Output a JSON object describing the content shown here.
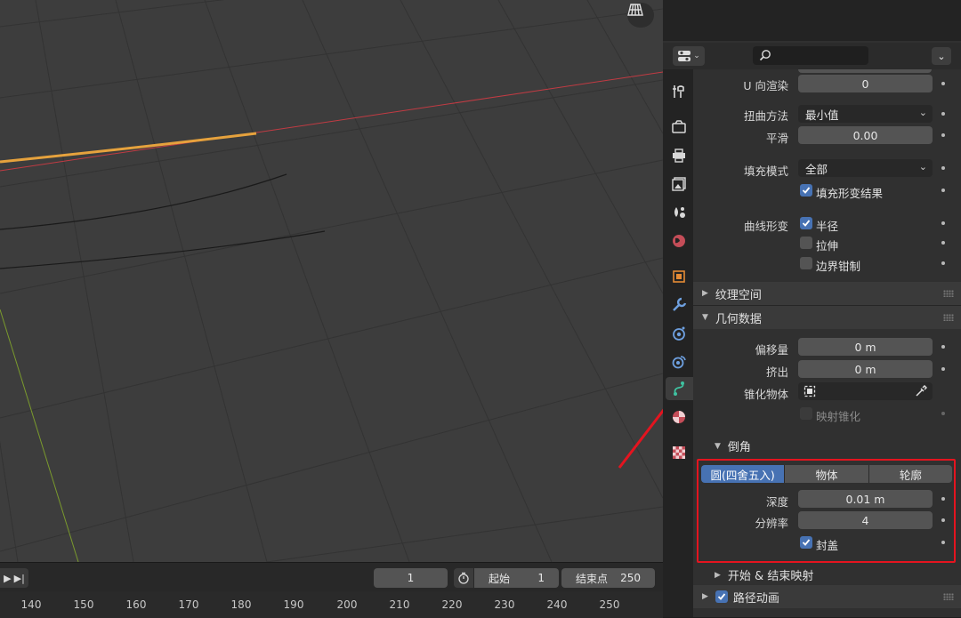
{
  "viewport": {
    "gizmo_icon": "grid-view-icon",
    "colors": {
      "bg": "#3d3d3d",
      "x_axis": "#c13b43",
      "y_axis": "#7a9a2d",
      "curve_selected": "#e6a23d",
      "grid": "#353535"
    }
  },
  "timeline": {
    "current_frame": "1",
    "start_label": "起始",
    "start_value": "1",
    "end_label": "结束点",
    "end_value": "250",
    "ticks": [
      "140",
      "150",
      "160",
      "170",
      "180",
      "190",
      "200",
      "210",
      "220",
      "230",
      "240",
      "250"
    ]
  },
  "properties": {
    "search_placeholder": "",
    "tabs": [
      "tool-icon",
      "render-icon",
      "output-icon",
      "view-layer-icon",
      "scene-icon",
      "world-icon",
      "object-icon",
      "modifier-icon",
      "particles-icon",
      "physics-icon",
      "curve-data-icon",
      "material-icon",
      "texture-icon"
    ],
    "active_tab": "curve-data-icon",
    "u_render": {
      "label": "U 向渲染",
      "value": "0"
    },
    "twist_method": {
      "label": "扭曲方法",
      "value": "最小值"
    },
    "smooth": {
      "label": "平滑",
      "value": "0.00"
    },
    "fill_mode": {
      "label": "填充模式",
      "value": "全部"
    },
    "fill_deform": {
      "label": "填充形变结果",
      "checked": true
    },
    "curve_deform": {
      "label": "曲线形变"
    },
    "radius": {
      "label": "半径",
      "checked": true
    },
    "stretch": {
      "label": "拉伸",
      "checked": false
    },
    "bounds_clamp": {
      "label": "边界钳制",
      "checked": false
    },
    "texture_space": {
      "label": "纹理空间"
    },
    "geometry": {
      "label": "几何数据"
    },
    "offset": {
      "label": "偏移量",
      "value": "0 m"
    },
    "extrude": {
      "label": "挤出",
      "value": "0 m"
    },
    "taper": {
      "label": "锥化物体"
    },
    "map_taper": {
      "label": "映射锥化",
      "checked": false
    },
    "bevel": {
      "label": "倒角",
      "modes": [
        "圆(四舍五入)",
        "物体",
        "轮廓"
      ],
      "selected_mode": "圆(四舍五入)",
      "depth": {
        "label": "深度",
        "value": "0.01 m"
      },
      "resolution": {
        "label": "分辨率",
        "value": "4"
      },
      "fill_caps": {
        "label": "封盖",
        "checked": true
      }
    },
    "start_end_mapping": {
      "label": "开始 & 结束映射"
    },
    "path_animation": {
      "label": "路径动画",
      "checked": true
    }
  },
  "annotation": {
    "color": "#e4141f"
  }
}
